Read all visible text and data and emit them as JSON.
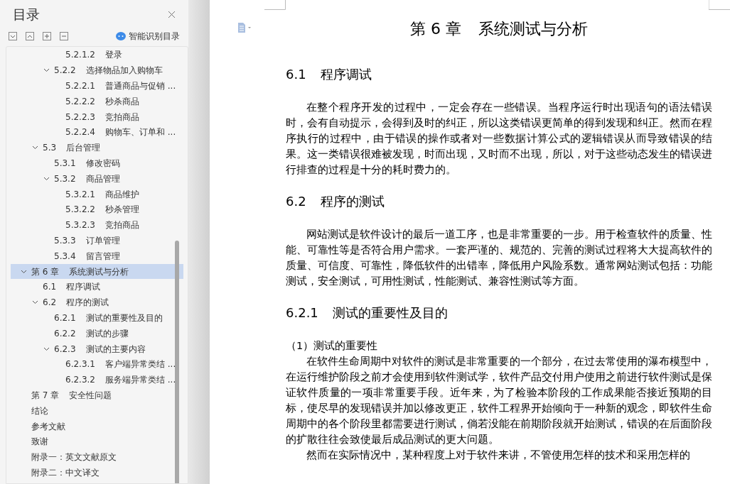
{
  "sidebar": {
    "title": "目录",
    "smart_button": "智能识别目录",
    "toc": [
      {
        "children": [
          {
            "children": [
              {
                "children": [
                  {
                    "number": "5.2.1.2",
                    "title": "登录",
                    "selected": false
                  }
                ]
              },
              {
                "number": "5.2.2",
                "title": "选择物品加入购物车",
                "expanded": true,
                "selected": false,
                "children": [
                  {
                    "number": "5.2.2.1",
                    "title": "普通商品与促销 ...",
                    "selected": false
                  },
                  {
                    "number": "5.2.2.2",
                    "title": "秒杀商品",
                    "selected": false
                  },
                  {
                    "number": "5.2.2.3",
                    "title": "竞拍商品",
                    "selected": false
                  },
                  {
                    "number": "5.2.2.4",
                    "title": "购物车、订单和 ...",
                    "selected": false
                  }
                ]
              }
            ]
          },
          {
            "number": "5.3",
            "title": "后台管理",
            "expanded": true,
            "selected": false,
            "children": [
              {
                "number": "5.3.1",
                "title": "修改密码",
                "selected": false
              },
              {
                "number": "5.3.2",
                "title": "商品管理",
                "expanded": true,
                "selected": false,
                "children": [
                  {
                    "number": "5.3.2.1",
                    "title": "商品维护",
                    "selected": false
                  },
                  {
                    "number": "5.3.2.2",
                    "title": "秒杀管理",
                    "selected": false
                  },
                  {
                    "number": "5.3.2.3",
                    "title": "竞拍商品",
                    "selected": false
                  }
                ]
              },
              {
                "number": "5.3.3",
                "title": "订单管理",
                "selected": false
              },
              {
                "number": "5.3.4",
                "title": "留言管理",
                "selected": false
              }
            ]
          }
        ]
      },
      {
        "number": "第 6 章",
        "title": "系统测试与分析",
        "expanded": true,
        "selected": true,
        "children": [
          {
            "number": "6.1",
            "title": "程序调试",
            "selected": false
          },
          {
            "number": "6.2",
            "title": "程序的测试",
            "expanded": true,
            "selected": false,
            "children": [
              {
                "number": "6.2.1",
                "title": "测试的重要性及目的",
                "selected": false
              },
              {
                "number": "6.2.2",
                "title": "测试的步骤",
                "selected": false
              },
              {
                "number": "6.2.3",
                "title": "测试的主要内容",
                "expanded": true,
                "selected": false,
                "children": [
                  {
                    "number": "6.2.3.1",
                    "title": "客户端异常类结 ...",
                    "selected": false
                  },
                  {
                    "number": "6.2.3.2",
                    "title": "服务端异常类结 ...",
                    "selected": false
                  }
                ]
              }
            ]
          }
        ]
      },
      {
        "number": "第 7 章",
        "title": "安全性问题",
        "selected": false
      },
      {
        "title": "结论",
        "selected": false
      },
      {
        "title": "参考文献",
        "selected": false
      },
      {
        "title": "致谢",
        "selected": false
      },
      {
        "title": "附录一：英文文献原文",
        "selected": false
      },
      {
        "title": "附录二：中文译文",
        "selected": false
      }
    ]
  },
  "document": {
    "chapter_number": "第 6 章",
    "chapter_title": "系统测试与分析",
    "blocks": [
      {
        "kind": "heading",
        "number": "6.1",
        "text": "程序调试"
      },
      {
        "kind": "paragraph",
        "text": "在整个程序开发的过程中，一定会存在一些错误。当程序运行时出现语句的语法错误时，会有自动提示，会得到及时的纠正，所以这类错误更简单的得到发现和纠正。然而在程序执行的过程中，由于错误的操作或者对一些数据计算公式的逻辑错误从而导致错误的结果。这一类错误很难被发现，时而出现，又时而不出现，所以，对于这些动态发生的错误进行排查的过程是十分的耗时费力的。"
      },
      {
        "kind": "heading",
        "number": "6.2",
        "text": "程序的测试"
      },
      {
        "kind": "paragraph",
        "text": "网站测试是软件设计的最后一道工序，也是非常重要的一步。用于检查软件的质量、性能、可靠性等是否符合用户需求。一套严谨的、规范的、完善的测试过程将大大提高软件的质量、可信度、可靠性，降低软件的出错率，降低用户风险系数。通常网站测试包括：功能测试，安全测试，可用性测试，性能测试、兼容性测试等方面。"
      },
      {
        "kind": "heading",
        "number": "6.2.1",
        "text": "测试的重要性及目的"
      },
      {
        "kind": "label",
        "text": "（1）测试的重要性"
      },
      {
        "kind": "paragraph",
        "text": "在软件生命周期中对软件的测试是非常重要的一个部分，在过去常使用的瀑布模型中，在运行维护阶段之前才会使用到软件测试学，软件产品交付用户使用之前进行软件测试是保证软件质量的一项非常重要手段。近年来，为了检验本阶段的工作成果能否接近预期的目标，使尽早的发现错误并加以修改更正，软件工程界开始倾向于一种新的观念，即软件生命周期中的各个阶段里都需要进行测试，倘若没能在前期阶段就开始测试，错误的在后面阶段的扩散往往会致使最后成品测试的更大问题。"
      },
      {
        "kind": "paragraph",
        "text": "然而在实际情况中，某种程度上对于软件来讲，不管使用怎样的技术和采用怎样的"
      }
    ]
  }
}
